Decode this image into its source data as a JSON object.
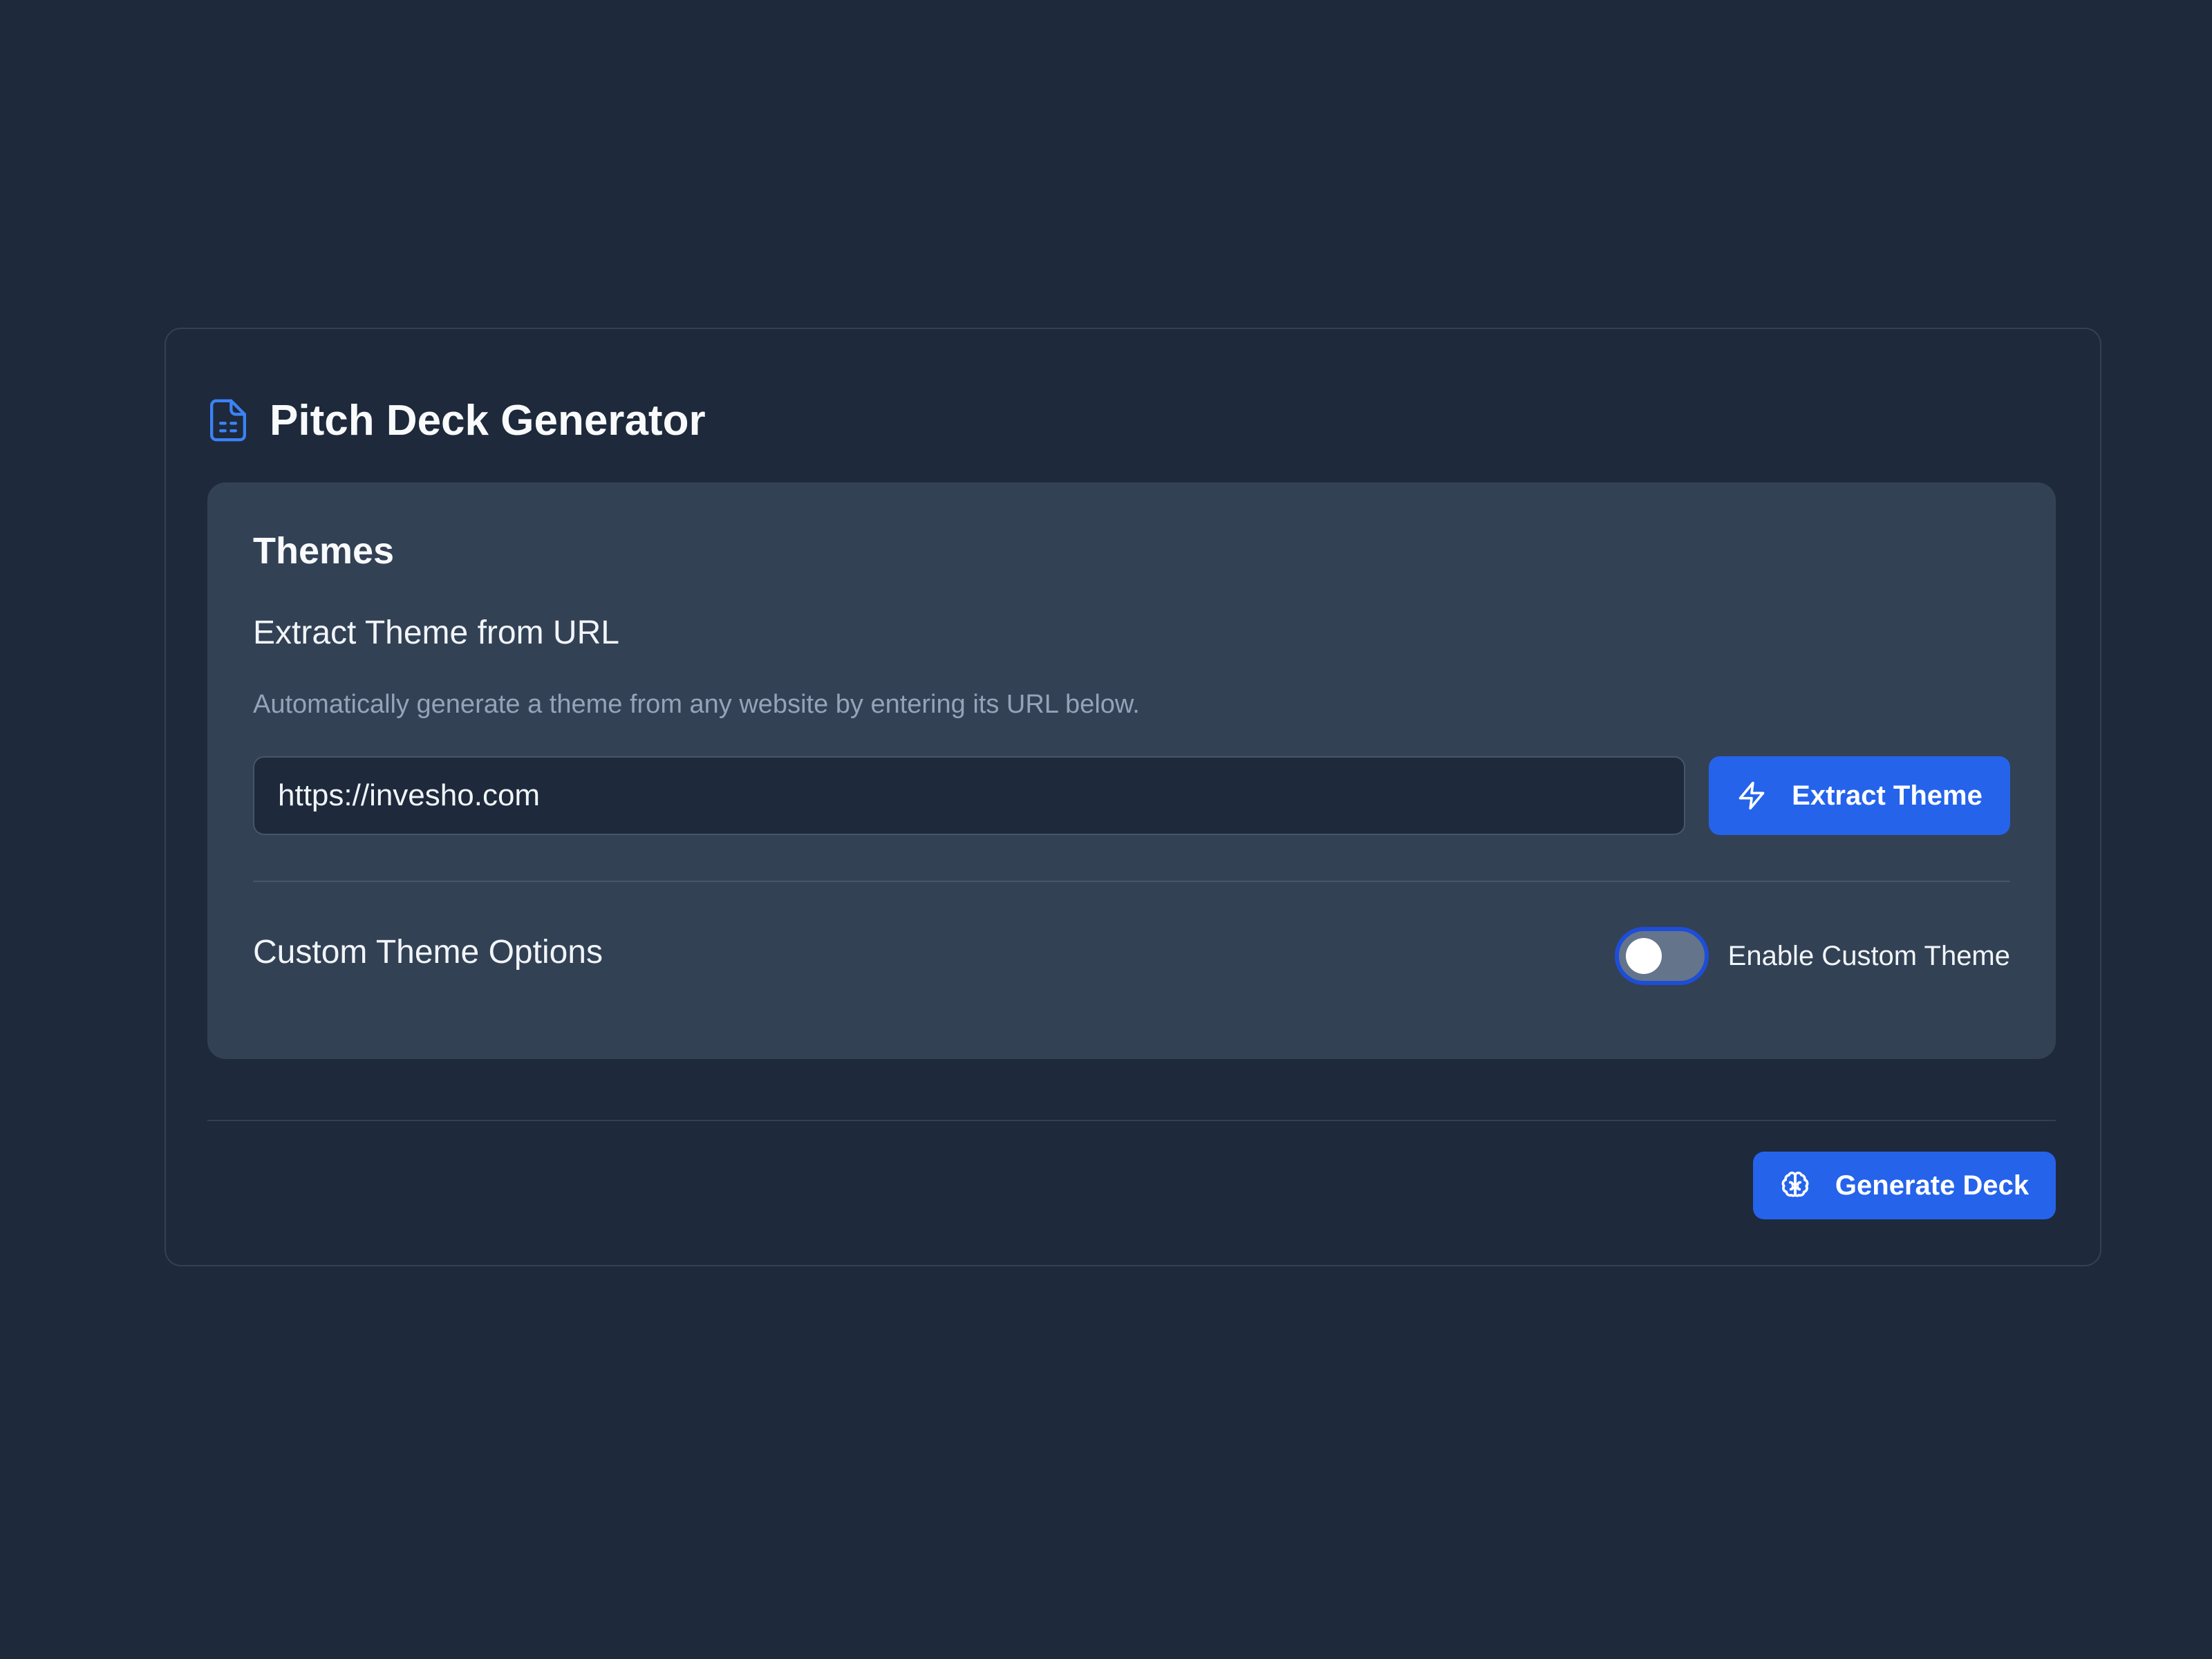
{
  "app": {
    "title": "Pitch Deck Generator",
    "title_icon": "file-text-icon"
  },
  "themes": {
    "section_title": "Themes",
    "extract": {
      "title": "Extract Theme from URL",
      "description": "Automatically generate a theme from any website by entering its URL below.",
      "url_value": "https://invesho.com",
      "button_label": "Extract Theme",
      "button_icon": "zap-icon"
    },
    "custom": {
      "title": "Custom Theme Options",
      "toggle_label": "Enable Custom Theme",
      "toggle_enabled": false
    }
  },
  "footer": {
    "generate_label": "Generate Deck",
    "generate_icon": "brain-icon"
  },
  "colors": {
    "background": "#1e293b",
    "panel": "#334155",
    "accent": "#2563eb",
    "icon_accent": "#3b82f6",
    "muted_text": "#94a3b8"
  }
}
